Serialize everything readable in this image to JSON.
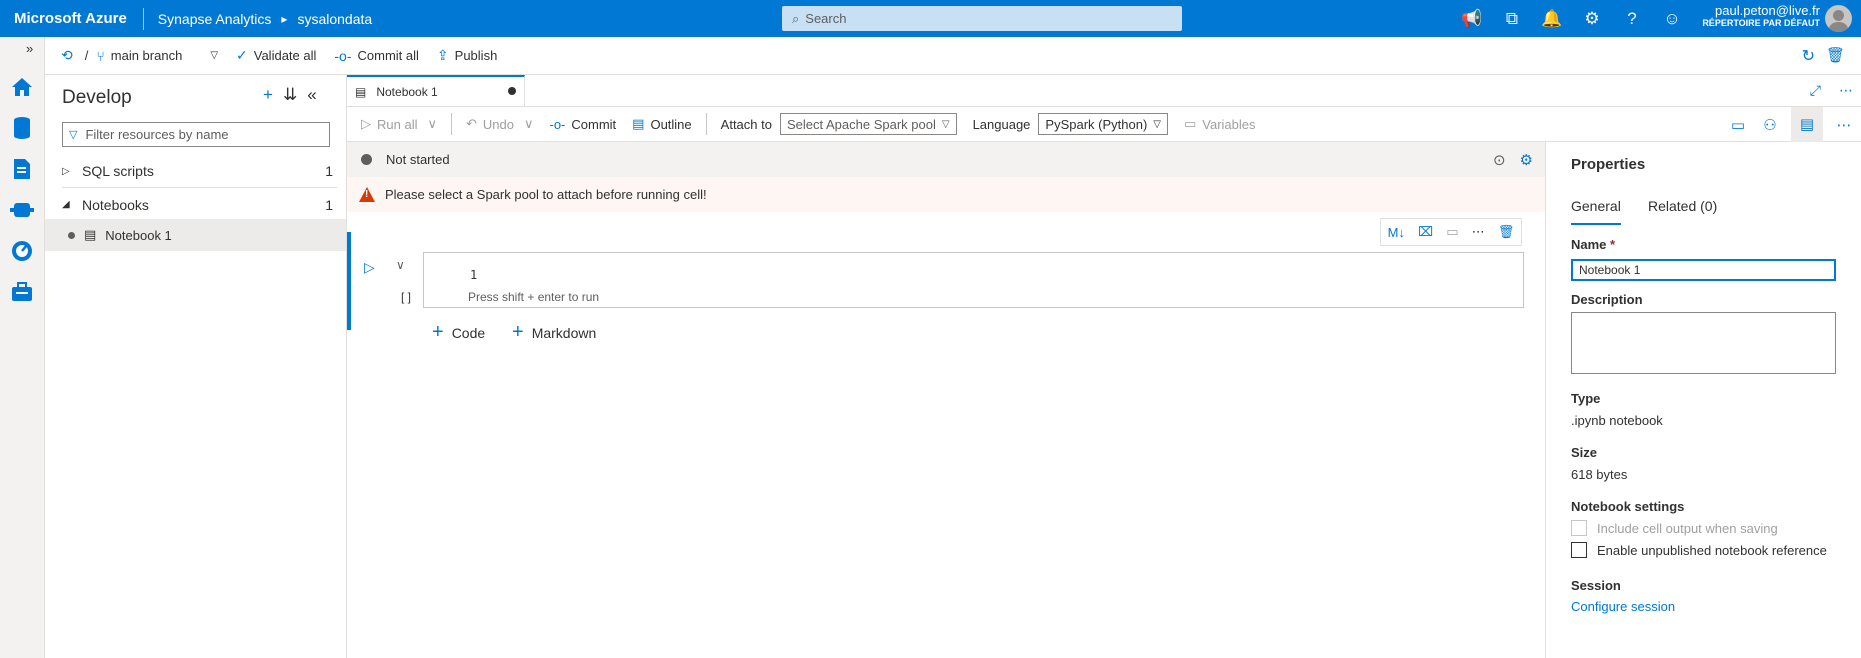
{
  "topbar": {
    "brand": "Microsoft Azure",
    "service": "Synapse Analytics",
    "separator": "▸",
    "workspace": "sysalondata",
    "search_placeholder": "Search",
    "user_name": "paul.peton@live.fr",
    "user_directory": "RÉPERTOIRE PAR DÉFAUT"
  },
  "toolbar": {
    "slash": "/",
    "branch": "main branch",
    "validate_all": "Validate all",
    "commit_all": "Commit all",
    "publish": "Publish"
  },
  "develop": {
    "title": "Develop",
    "filter_placeholder": "Filter resources by name",
    "groups": [
      {
        "label": "SQL scripts",
        "count": "1",
        "expanded": false
      },
      {
        "label": "Notebooks",
        "count": "1",
        "expanded": true
      }
    ],
    "items": [
      {
        "label": "Notebook 1"
      }
    ]
  },
  "tabs": [
    {
      "label": "Notebook 1",
      "modified": true
    }
  ],
  "notebook_toolbar": {
    "run_all": "Run all",
    "undo": "Undo",
    "commit": "Commit",
    "outline": "Outline",
    "attach_to_label": "Attach to",
    "attach_to_value": "Select Apache Spark pool",
    "language_label": "Language",
    "language_value": "PySpark (Python)",
    "variables": "Variables"
  },
  "status": {
    "text": "Not started",
    "warning": "Please select a Spark pool to attach before running cell!"
  },
  "cell": {
    "exec_count": "[ ]",
    "line_number": "1",
    "placeholder": "Press shift + enter to run",
    "tools": [
      "ML",
      "clear-output",
      "comment",
      "more",
      "delete"
    ]
  },
  "add_cell": {
    "code": "Code",
    "markdown": "Markdown"
  },
  "properties": {
    "title": "Properties",
    "tabs": [
      "General",
      "Related (0)"
    ],
    "name_label": "Name",
    "required_mark": "*",
    "name_value": "Notebook 1",
    "description_label": "Description",
    "type_label": "Type",
    "type_value": ".ipynb notebook",
    "size_label": "Size",
    "size_value": "618 bytes",
    "settings_label": "Notebook settings",
    "opt_include_output": "Include cell output when saving",
    "opt_unpublished_ref": "Enable unpublished notebook reference",
    "session_label": "Session",
    "configure_session": "Configure session"
  },
  "colors": {
    "accent": "#0078d4",
    "warning": "#d83b01"
  }
}
